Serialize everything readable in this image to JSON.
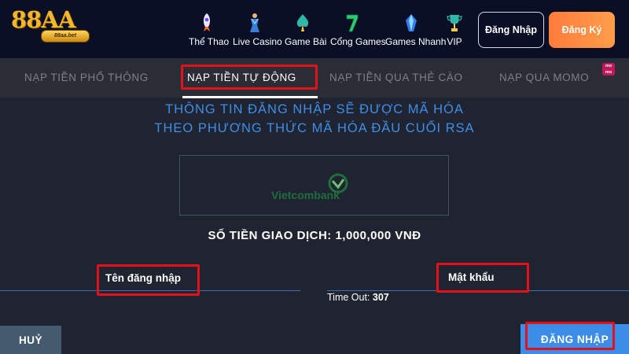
{
  "brand": {
    "logo_text": "88AA",
    "logo_ribbon": "88aa.bet"
  },
  "nav": {
    "items": [
      {
        "label": "Thể Thao",
        "icon": "rocket-icon"
      },
      {
        "label": "Live Casino",
        "icon": "dancer-icon"
      },
      {
        "label": "Game Bài",
        "icon": "spade-icon"
      },
      {
        "label": "Cổng Games",
        "icon": "seven-icon"
      },
      {
        "label": "Games Nhanh",
        "icon": "gem-icon"
      },
      {
        "label": "VIP",
        "icon": "trophy-icon"
      }
    ],
    "login_label": "Đăng Nhập",
    "register_label": "Đăng Ký"
  },
  "tabs": {
    "items": [
      {
        "label": "NẠP TIỀN PHỔ THÔNG"
      },
      {
        "label": "NẠP TIỀN TỰ ĐỘNG"
      },
      {
        "label": "NẠP TIỀN QUA THẺ CÀO"
      },
      {
        "label": "NẠP QUA MOMO"
      }
    ],
    "active_index": 1,
    "momo_badge": "mo mo"
  },
  "main": {
    "info_line_1": "THÔNG TIN ĐĂNG NHẬP SẼ ĐƯỢC MÃ HÓA",
    "info_line_2": "THEO PHƯƠNG THỨC MÃ HÓA ĐẦU CUỐI RSA",
    "bank_name": "Vietcombank",
    "amount_text": "SỐ TIỀN GIAO DỊCH: 1,000,000 VNĐ",
    "username_label": "Tên đăng nhập",
    "password_label": "Mật khẩu",
    "timeout_label": "Time Out:",
    "timeout_value": "307",
    "cancel_label": "HUỶ",
    "submit_label": "ĐĂNG NHẬP"
  },
  "colors": {
    "header_bg": "#0b0f26",
    "page_bg": "#1f2430",
    "tab_bar_bg": "#2a2d36",
    "info_text": "#3f8ee8",
    "register_button": "#ff8a40",
    "submit_button": "#3b8de8",
    "cancel_button": "#465a6e",
    "highlight": "#e4101a",
    "bank_green": "#1f6e3d"
  }
}
